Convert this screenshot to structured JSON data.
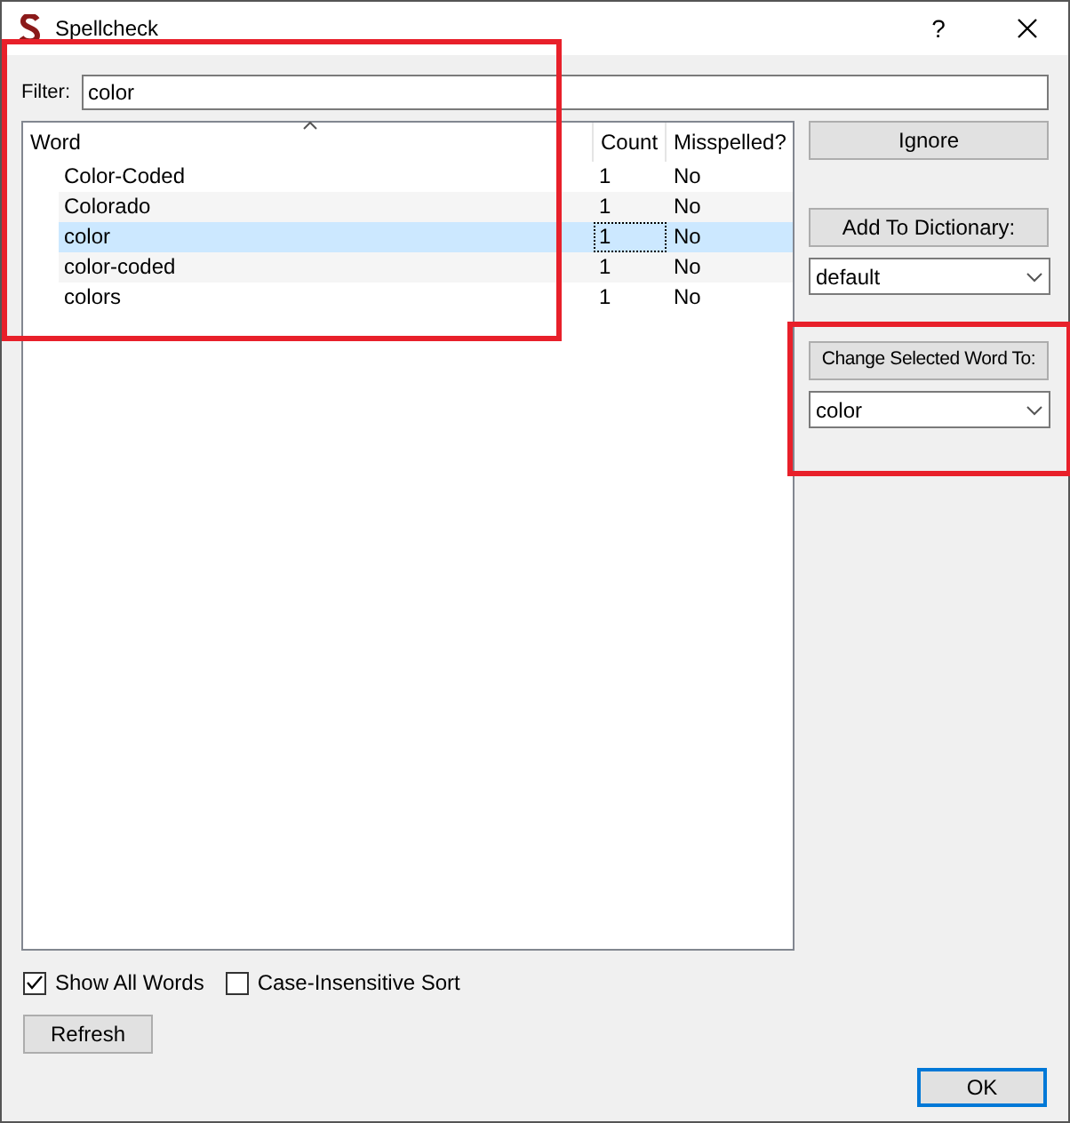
{
  "window": {
    "title": "Spellcheck",
    "help": "?"
  },
  "filter": {
    "label": "Filter:",
    "value": "color"
  },
  "table": {
    "columns": [
      "Word",
      "Count",
      "Misspelled?"
    ],
    "rows": [
      {
        "word": "Color-Coded",
        "count": "1",
        "misspelled": "No",
        "selected": false
      },
      {
        "word": "Colorado",
        "count": "1",
        "misspelled": "No",
        "selected": false
      },
      {
        "word": "color",
        "count": "1",
        "misspelled": "No",
        "selected": true
      },
      {
        "word": "color-coded",
        "count": "1",
        "misspelled": "No",
        "selected": false
      },
      {
        "word": "colors",
        "count": "1",
        "misspelled": "No",
        "selected": false
      }
    ]
  },
  "side": {
    "ignore": "Ignore",
    "add": "Add To Dictionary:",
    "dictionary": "default",
    "change": "Change Selected Word To:",
    "replacement": "color"
  },
  "options": [
    {
      "label": "Show All Words",
      "checked": true
    },
    {
      "label": "Case-Insensitive Sort",
      "checked": false
    }
  ],
  "buttons": {
    "refresh": "Refresh",
    "ok": "OK"
  }
}
